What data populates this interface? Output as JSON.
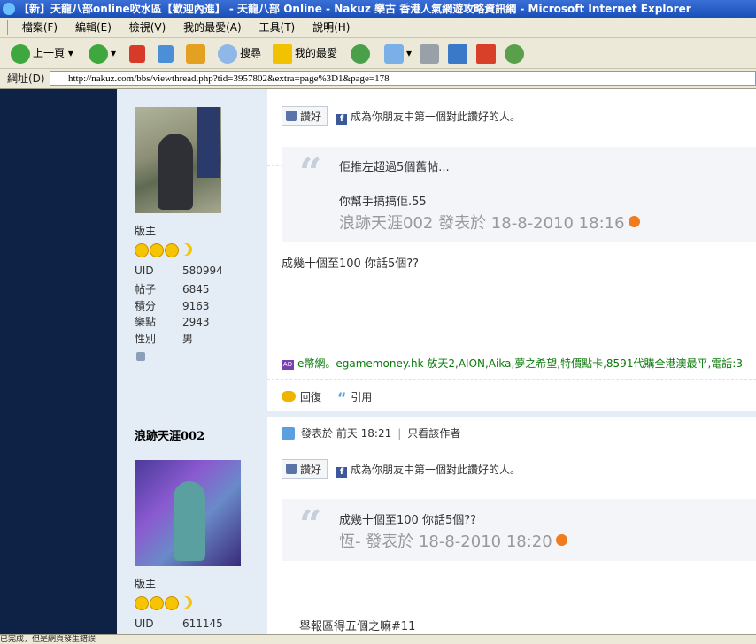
{
  "window": {
    "title": "【新】天龍八部online吹水區【歡迎內進】 - 天龍八部 Online - Nakuz 樂古 香港人氣網遊攻略資訊網 - Microsoft Internet Explorer"
  },
  "menu": [
    "檔案(F)",
    "編輯(E)",
    "檢視(V)",
    "我的最愛(A)",
    "工具(T)",
    "說明(H)"
  ],
  "toolbar": {
    "back": "上一頁",
    "search": "搜尋",
    "favorites": "我的最愛"
  },
  "address": {
    "label": "網址(D)",
    "url": "http://nakuz.com/bbs/viewthread.php?tid=3957802&extra=page%3D1&page=178"
  },
  "post1": {
    "rank": "版主",
    "stats": [
      {
        "k": "UID",
        "v": "580994"
      },
      {
        "k": "帖子",
        "v": "6845"
      },
      {
        "k": "積分",
        "v": "9163"
      },
      {
        "k": "樂點",
        "v": "2943"
      },
      {
        "k": "性別",
        "v": "男"
      }
    ],
    "like": "讚好",
    "fb_note": "成為你朋友中第一個對此讚好的人。",
    "quote_line1": "佢推左超過5個舊帖...",
    "quote_line2": "你幫手搞搞佢.55",
    "quote_by": "浪跡天涯002 發表於 18-8-2010 18:16",
    "body": "成幾十個至100 你話5個??",
    "ad": "e幣網。egamemoney.hk 放天2,AION,Aika,夢之希望,特價點卡,8591代購全港澳最平,電話:3",
    "ad_tag": "AD",
    "reply": "回復",
    "quote_btn": "引用"
  },
  "post2": {
    "username": "浪跡天涯002",
    "meta_posted": "發表於 前天 18:21",
    "meta_author": "只看該作者",
    "rank": "版主",
    "stats": [
      {
        "k": "UID",
        "v": "611145"
      }
    ],
    "like": "讚好",
    "fb_note": "成為你朋友中第一個對此讚好的人。",
    "quote_line1": "成幾十個至100 你話5個??",
    "quote_by": "恆- 發表於 18-8-2010 18:20",
    "body": "舉報區得五個之嘛#11"
  },
  "statusbar": {
    "text": "已完成，但是網頁發生錯誤"
  }
}
